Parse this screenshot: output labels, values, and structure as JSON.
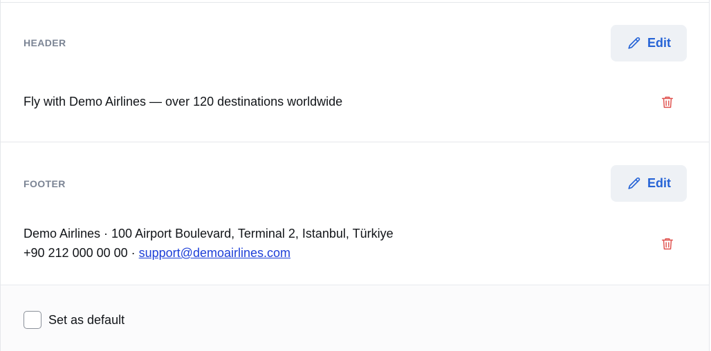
{
  "sections": {
    "header": {
      "label": "HEADER",
      "edit_label": "Edit",
      "text": "Fly with Demo Airlines — over 120 destinations worldwide"
    },
    "footer": {
      "label": "FOOTER",
      "edit_label": "Edit",
      "line1": "Demo Airlines · 100 Airport Boulevard, Terminal 2, Istanbul, Türkiye",
      "line2_prefix": "+90 212 000 00 00 · ",
      "email": "support@demoairlines.com"
    }
  },
  "default_option": {
    "label": "Set as default",
    "checked": false
  },
  "icons": {
    "edit": "pencil-icon",
    "delete": "trash-icon"
  },
  "colors": {
    "accent": "#2563d6",
    "danger": "#e0524f",
    "label_gray": "#7b8494",
    "link": "#1d3fd8"
  }
}
